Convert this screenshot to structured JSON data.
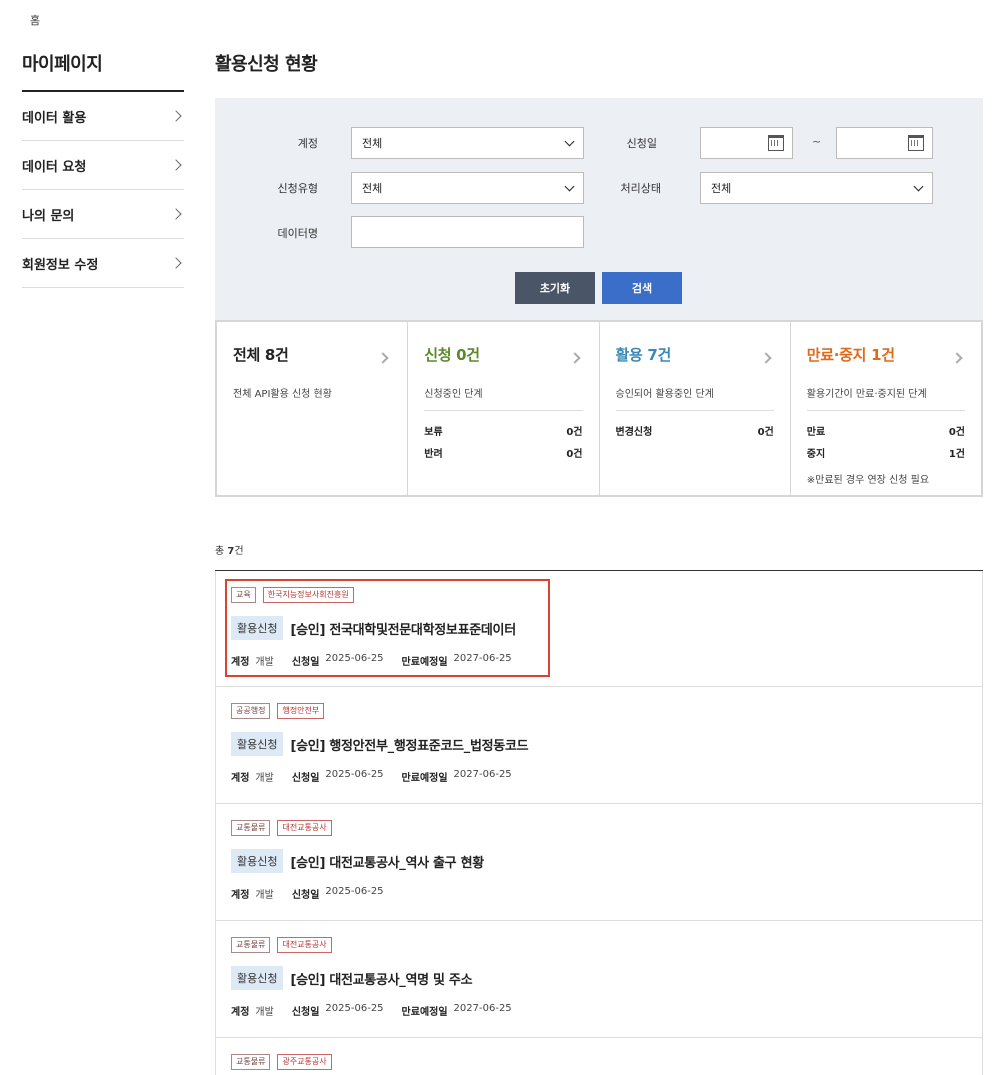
{
  "breadcrumb": "홈",
  "sidebar": {
    "title": "마이페이지",
    "items": [
      {
        "label": "데이터 활용"
      },
      {
        "label": "데이터 요청"
      },
      {
        "label": "나의 문의"
      },
      {
        "label": "회원정보 수정"
      }
    ]
  },
  "page_title": "활용신청 현황",
  "search": {
    "account_label": "계정",
    "account_value": "전체",
    "date_label": "신청일",
    "date_sep": "~",
    "type_label": "신청유형",
    "type_value": "전체",
    "status_label": "처리상태",
    "status_value": "전체",
    "dataname_label": "데이터명",
    "reset_label": "초기화",
    "search_label": "검색"
  },
  "summary": [
    {
      "title": "전체 8건",
      "color": "#222222",
      "desc": "전체 API활용 신청 현황",
      "rows": [],
      "note": ""
    },
    {
      "title": "신청 0건",
      "color": "#5a8a2a",
      "desc": "신청중인 단계",
      "rows": [
        {
          "k": "보류",
          "v": "0건"
        },
        {
          "k": "반려",
          "v": "0건"
        }
      ],
      "note": ""
    },
    {
      "title": "활용 7건",
      "color": "#3a87b8",
      "desc": "승인되어 활용중인 단계",
      "rows": [
        {
          "k": "변경신청",
          "v": "0건"
        }
      ],
      "note": ""
    },
    {
      "title": "만료·중지 1건",
      "color": "#e06a1a",
      "desc": "활용기간이 만료·중지된 단계",
      "rows": [
        {
          "k": "만료",
          "v": "0건"
        },
        {
          "k": "중지",
          "v": "1건"
        }
      ],
      "note": "※만료된 경우 연장 신청 필요"
    }
  ],
  "total": {
    "prefix": "총 ",
    "count": "7",
    "suffix": "건"
  },
  "meta_labels": {
    "account": "계정",
    "applied": "신청일",
    "expires": "만료예정일"
  },
  "items": [
    {
      "cat": "교육",
      "org": "한국지능정보사회진흥원",
      "badge": "활용신청",
      "title": "[승인] 전국대학및전문대학정보표준데이터",
      "account": "개발",
      "applied": "2025-06-25",
      "expires": "2027-06-25"
    },
    {
      "cat": "공공행정",
      "org": "행정안전부",
      "badge": "활용신청",
      "title": "[승인] 행정안전부_행정표준코드_법정동코드",
      "account": "개발",
      "applied": "2025-06-25",
      "expires": "2027-06-25"
    },
    {
      "cat": "교통물류",
      "org": "대전교통공사",
      "badge": "활용신청",
      "title": "[승인] 대전교통공사_역사 출구 현황",
      "account": "개발",
      "applied": "2025-06-25",
      "expires": ""
    },
    {
      "cat": "교통물류",
      "org": "대전교통공사",
      "badge": "활용신청",
      "title": "[승인] 대전교통공사_역명 및 주소",
      "account": "개발",
      "applied": "2025-06-25",
      "expires": "2027-06-25"
    },
    {
      "cat": "교통물류",
      "org": "광주교통공사",
      "badge": "",
      "title": "",
      "account": "",
      "applied": "",
      "expires": ""
    }
  ]
}
